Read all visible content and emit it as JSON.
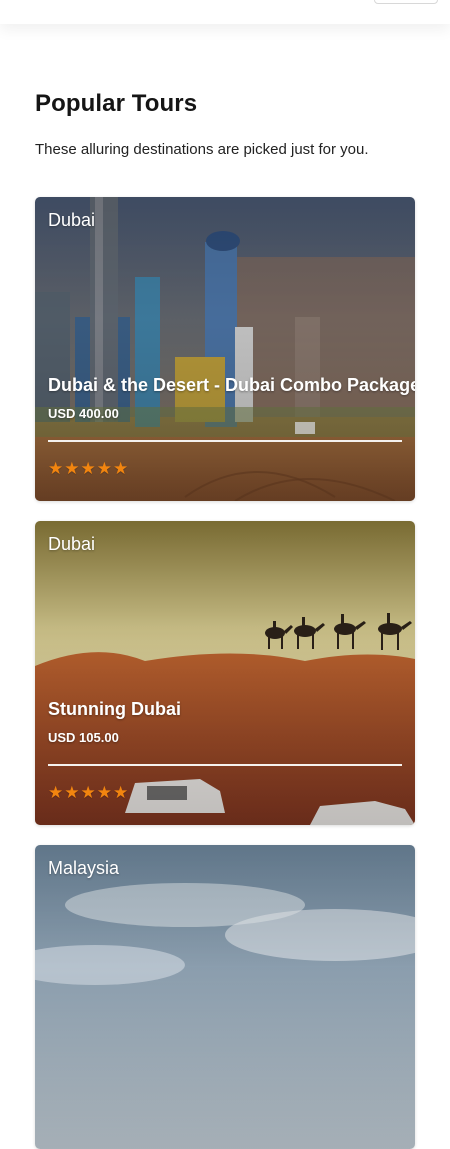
{
  "section": {
    "title": "Popular Tours",
    "subtitle": "These alluring destinations are picked just for you."
  },
  "tours": [
    {
      "region": "Dubai",
      "title": "Dubai & the Desert - Dubai Combo Package",
      "price": "USD 400.00",
      "rating": 5,
      "stars": "★★★★★"
    },
    {
      "region": "Dubai",
      "title": "Stunning Dubai",
      "price": "USD 105.00",
      "rating": 5,
      "stars": "★★★★★"
    },
    {
      "region": "Malaysia"
    }
  ],
  "colors": {
    "star": "#f2850f",
    "text": "#1a1a1a",
    "background": "#ffffff"
  }
}
